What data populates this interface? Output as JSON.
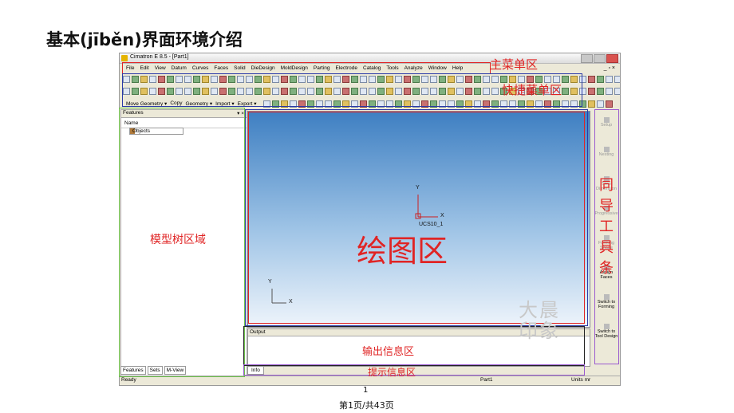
{
  "slide": {
    "title": "基本(jīběn)界面环境介绍",
    "page_number": "1",
    "page_count": "第1页/共43页"
  },
  "window": {
    "title": "Cimatron E 8.5 - [Part1]",
    "right_controls": "_ ▫ ×"
  },
  "menu": {
    "items": [
      "File",
      "Edit",
      "View",
      "Datum",
      "Curves",
      "Faces",
      "Solid",
      "DieDesign",
      "MoldDesign",
      "Parting",
      "Electrode",
      "Catalog",
      "Tools",
      "Analyze",
      "Window",
      "Help"
    ]
  },
  "toolbar_text": {
    "items": [
      "Move Geometry ▾",
      "Copy",
      "Geometry ▾",
      "Import ▾",
      "Export ▾"
    ]
  },
  "features": {
    "header": "Features",
    "pin": "▾ ×",
    "column": "Name",
    "node": "Objects",
    "tabs": [
      "Features",
      "Sets",
      "M-View"
    ]
  },
  "graphics": {
    "axis_y": "Y",
    "axis_x": "X",
    "ucs_label": "UCS10_1",
    "small_y": "Y",
    "small_x": "X"
  },
  "output": {
    "header": "Output",
    "info_tab": "Info"
  },
  "status": {
    "ready": "Ready",
    "part": "Part1",
    "units": "Units mr"
  },
  "wizard": {
    "items": [
      {
        "label": "Setup",
        "dim": true
      },
      {
        "label": "Nesting",
        "dim": true
      },
      {
        "label": "Strip Dimension",
        "dim": true
      },
      {
        "label": "Progressive",
        "dim": true
      },
      {
        "label": "Forming Shape",
        "dim": true
      },
      {
        "label": "Assign Faces",
        "dim": false
      },
      {
        "label": "Switch to Forming",
        "dim": false
      },
      {
        "label": "Switch to Tool Design",
        "dim": false
      }
    ]
  },
  "annotations": {
    "main_menu": "主菜单区",
    "quick_menu": "快捷菜单区",
    "model_tree": "模型树区域",
    "drawing_area": "绘图区",
    "output_area": "输出信息区",
    "prompt_area": "提示信息区",
    "wizard_bar": [
      "同",
      "导",
      "工",
      "具",
      "条"
    ],
    "watermark": "大晨 印象"
  },
  "colors": {
    "red_box": "#e02424",
    "blue_box": "#2b3aa8",
    "green_box": "#6cc04a",
    "purple_box": "#9a5ad0"
  }
}
